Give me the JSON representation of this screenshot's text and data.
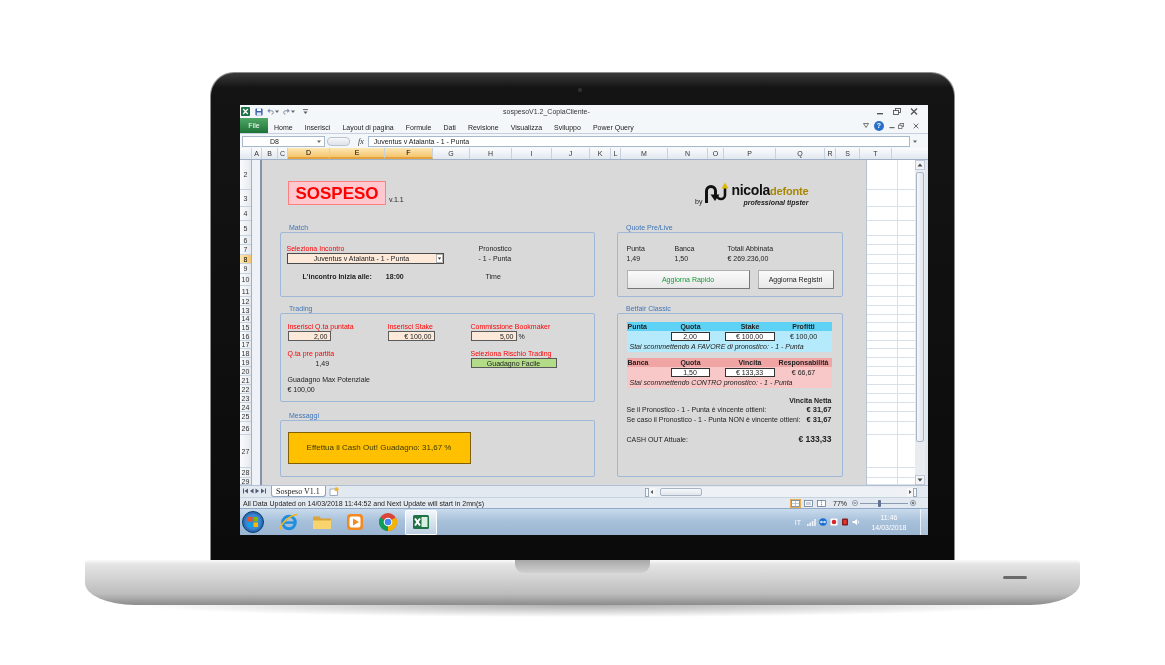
{
  "window": {
    "title": "sospesoV1.2_CopiaCliente-"
  },
  "ribbon": {
    "file": "File",
    "help": "?",
    "tabs": [
      {
        "label": "Home",
        "selected": false
      },
      {
        "label": "Inserisci",
        "selected": false
      },
      {
        "label": "Layout di pagina",
        "selected": false
      },
      {
        "label": "Formule",
        "selected": false
      },
      {
        "label": "Dati",
        "selected": false
      },
      {
        "label": "Revisione",
        "selected": false
      },
      {
        "label": "Visualizza",
        "selected": false
      },
      {
        "label": "Sviluppo",
        "selected": false
      },
      {
        "label": "Power Query",
        "selected": false
      }
    ]
  },
  "formula_bar": {
    "name_box": "D8",
    "function_button": "fx",
    "formula": "Juventus v Atalanta - 1 - Punta"
  },
  "columns": [
    {
      "label": "A",
      "selected": false
    },
    {
      "label": "B",
      "selected": false
    },
    {
      "label": "C",
      "selected": false
    },
    {
      "label": "D",
      "selected": true
    },
    {
      "label": "E",
      "selected": true
    },
    {
      "label": "F",
      "selected": true
    },
    {
      "label": "G",
      "selected": false
    },
    {
      "label": "H",
      "selected": false
    },
    {
      "label": "I",
      "selected": false
    },
    {
      "label": "J",
      "selected": false
    },
    {
      "label": "K",
      "selected": false
    },
    {
      "label": "L",
      "selected": false
    },
    {
      "label": "M",
      "selected": false
    },
    {
      "label": "N",
      "selected": false
    },
    {
      "label": "O",
      "selected": false
    },
    {
      "label": "P",
      "selected": false
    },
    {
      "label": "Q",
      "selected": false
    },
    {
      "label": "R",
      "selected": false
    },
    {
      "label": "S",
      "selected": false
    },
    {
      "label": "T",
      "selected": false
    }
  ],
  "rows": [
    {
      "label": "2",
      "selected": false
    },
    {
      "label": "3",
      "selected": false
    },
    {
      "label": "4",
      "selected": false
    },
    {
      "label": "5",
      "selected": false
    },
    {
      "label": "6",
      "selected": false
    },
    {
      "label": "7",
      "selected": false
    },
    {
      "label": "8",
      "selected": true
    },
    {
      "label": "9",
      "selected": false
    },
    {
      "label": "10",
      "selected": false
    },
    {
      "label": "11",
      "selected": false
    },
    {
      "label": "12",
      "selected": false
    },
    {
      "label": "13",
      "selected": false
    },
    {
      "label": "14",
      "selected": false
    },
    {
      "label": "15",
      "selected": false
    },
    {
      "label": "16",
      "selected": false
    },
    {
      "label": "17",
      "selected": false
    },
    {
      "label": "18",
      "selected": false
    },
    {
      "label": "19",
      "selected": false
    },
    {
      "label": "20",
      "selected": false
    },
    {
      "label": "21",
      "selected": false
    },
    {
      "label": "22",
      "selected": false
    },
    {
      "label": "23",
      "selected": false
    },
    {
      "label": "24",
      "selected": false
    },
    {
      "label": "25",
      "selected": false
    },
    {
      "label": "26",
      "selected": false
    },
    {
      "label": "27",
      "selected": false
    },
    {
      "label": "28",
      "selected": false
    },
    {
      "label": "29",
      "selected": false
    }
  ],
  "sheet": {
    "logo": {
      "title": "SOSPESO",
      "version": "v.1.1"
    },
    "brand": {
      "by": "by",
      "name": "nicola",
      "name_accent": "defonte",
      "tagline": "professional tipster"
    },
    "match": {
      "title": "Match",
      "select_label": "Seleziona Incontro",
      "selected_match": "Juventus v Atalanta - 1 - Punta",
      "forecast_label": "Pronostico",
      "forecast": "- 1 - Punta",
      "start_label": "L'incontro Inizia alle:",
      "start_time": "18:00",
      "time_label": "Time"
    },
    "odds": {
      "title": "Quote Pre/Live",
      "columns": [
        {
          "label": "Punta",
          "value": "1,49"
        },
        {
          "label": "Banca",
          "value": "1,50"
        },
        {
          "label": "Totali Abbinata",
          "value": "€ 269.236,00"
        }
      ],
      "buttons": [
        {
          "label": "Aggiorna Rapido",
          "kind": "primary"
        },
        {
          "label": "Aggiorna Registri",
          "kind": "default"
        }
      ]
    },
    "trading": {
      "title": "Trading",
      "odds_label": "Inserisci Q.ta puntata",
      "odds_value": "2,00",
      "stake_label": "Inserisci Stake",
      "stake_value": "€ 100,00",
      "commission_label": "Commissione Bookmaker",
      "commission_value": "5,00",
      "commission_unit": "%",
      "pre_odds_label": "Q.ta pre partita",
      "pre_odds": "1,49",
      "risk_label": "Seleziona Rischio Trading",
      "risk": "Guadagno Facile",
      "max_gain_label": "Guadagno Max Potenziale",
      "max_gain": "€ 100,00"
    },
    "messages": {
      "title": "Messaggi",
      "text": "Effettua il Cash Out! Guadagno: 31,67 %"
    },
    "betfair": {
      "title": "Betfair Classic",
      "bets": [
        {
          "kind": "back",
          "type_label": "Punta",
          "odds_label": "Quota",
          "amount_label": "Stake",
          "result_label": "Profitti",
          "odds": "2,00",
          "amount": "€ 100,00",
          "result": "€ 100,00",
          "note": "Stai scommettendo A FAVORE di pronostico: - 1 - Punta"
        },
        {
          "kind": "lay",
          "type_label": "Banca",
          "odds_label": "Quota",
          "amount_label": "Vincita",
          "result_label": "Responsabilità",
          "odds": "1,50",
          "amount": "€ 133,33",
          "result": "€ 66,67",
          "note": "Stai scommettendo CONTRO pronostico: - 1 - Punta"
        }
      ],
      "net_label": "Vincita Netta",
      "outcomes": [
        {
          "label": "Se il Pronostico - 1 - Punta è vincente ottieni:",
          "value": "€ 31,67"
        },
        {
          "label": "Se caso il Pronostico - 1 - Punta NON è vincente ottieni:",
          "value": "€ 31,67"
        }
      ],
      "cashout_label": "CASH OUT Attuale:",
      "cashout": "€ 133,33"
    }
  },
  "sheet_tabs": [
    {
      "label": "Sospeso V1.1",
      "selected": true
    }
  ],
  "status_bar": {
    "text": "All Data Updated on 14/03/2018 11:44:52 and Next Update will start in 2mn(s)",
    "views": [
      {
        "kind": "normal",
        "selected": true
      },
      {
        "kind": "page_layout",
        "selected": false
      },
      {
        "kind": "page_break",
        "selected": false
      }
    ],
    "zoom": "77%",
    "zoom_slider": {
      "level": 0.4
    }
  },
  "taskbar": {
    "apps": [
      {
        "kind": "ie",
        "selected": false
      },
      {
        "kind": "folder",
        "selected": false
      },
      {
        "kind": "media",
        "selected": false
      },
      {
        "kind": "chrome",
        "selected": false
      },
      {
        "kind": "excel",
        "selected": true
      }
    ],
    "language": "IT",
    "time": "11:46",
    "date": "14/03/2018"
  }
}
